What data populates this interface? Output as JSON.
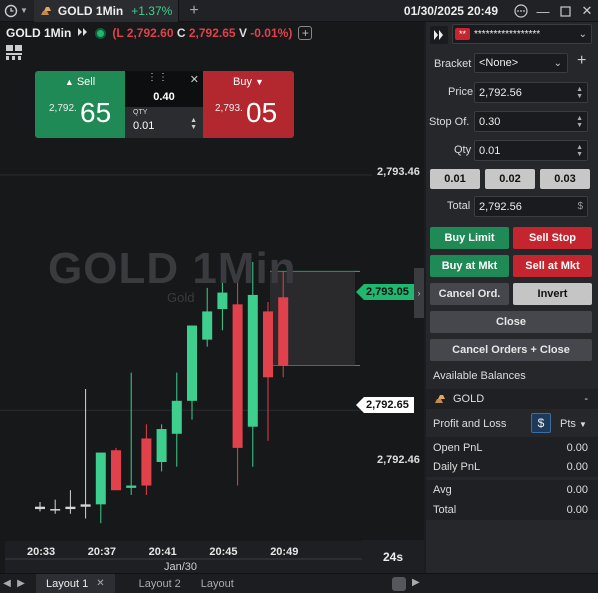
{
  "topbar": {
    "symbol_tab": "GOLD 1Min",
    "change": "+1.37%",
    "datetime": "01/30/2025 20:49"
  },
  "chart": {
    "title": "GOLD 1Min",
    "ohlc_l_label": "(L",
    "ohlc_l_value": "2,792.60",
    "ohlc_c_label": "C",
    "ohlc_c_value": "2,792.65",
    "ohlc_v_label": "V",
    "ohlc_v_value": "-0.01%",
    "ohlc_close": ")",
    "watermark": "GOLD 1Min",
    "watermark_sub": "Gold",
    "price_labels": {
      "top": "2,793.46",
      "ask": "2,793.05",
      "last": "2,792.65",
      "bottom": "2,792.46"
    },
    "countdown": "24s",
    "date_label": "Jan/30"
  },
  "trade_widget": {
    "sell_label": "Sell",
    "sell_prefix": "2,792.",
    "sell_big": "65",
    "buy_label": "Buy",
    "buy_prefix": "2,793.",
    "buy_big": "05",
    "spread": "0.40",
    "qty_label": "QTY",
    "qty_value": "0.01"
  },
  "chart_data": {
    "type": "candlestick",
    "x": [
      "20:32",
      "20:33",
      "20:34",
      "20:35",
      "20:36",
      "20:37",
      "20:38",
      "20:39",
      "20:40",
      "20:41",
      "20:42",
      "20:43",
      "20:44",
      "20:45",
      "20:46",
      "20:47",
      "20:48",
      "20:49"
    ],
    "candles": [
      {
        "o": 2792.05,
        "h": 2792.07,
        "l": 2792.03,
        "c": 2792.04,
        "dir": "flat"
      },
      {
        "o": 2792.04,
        "h": 2792.08,
        "l": 2792.02,
        "c": 2792.04,
        "dir": "flat"
      },
      {
        "o": 2792.04,
        "h": 2792.12,
        "l": 2792.02,
        "c": 2792.05,
        "dir": "flat"
      },
      {
        "o": 2792.05,
        "h": 2792.55,
        "l": 2792.0,
        "c": 2792.06,
        "dir": "flat"
      },
      {
        "o": 2792.06,
        "h": 2792.28,
        "l": 2791.98,
        "c": 2792.28,
        "dir": "up"
      },
      {
        "o": 2792.29,
        "h": 2792.3,
        "l": 2792.18,
        "c": 2792.12,
        "dir": "down"
      },
      {
        "o": 2792.13,
        "h": 2792.62,
        "l": 2792.1,
        "c": 2792.14,
        "dir": "up"
      },
      {
        "o": 2792.14,
        "h": 2792.4,
        "l": 2792.1,
        "c": 2792.34,
        "dir": "down"
      },
      {
        "o": 2792.24,
        "h": 2792.4,
        "l": 2792.2,
        "c": 2792.38,
        "dir": "up"
      },
      {
        "o": 2792.36,
        "h": 2792.62,
        "l": 2792.22,
        "c": 2792.5,
        "dir": "up"
      },
      {
        "o": 2792.5,
        "h": 2792.79,
        "l": 2792.42,
        "c": 2792.82,
        "dir": "up"
      },
      {
        "o": 2792.76,
        "h": 2792.98,
        "l": 2792.73,
        "c": 2792.88,
        "dir": "up"
      },
      {
        "o": 2792.89,
        "h": 2793.08,
        "l": 2792.8,
        "c": 2792.96,
        "dir": "up"
      },
      {
        "o": 2792.91,
        "h": 2793.04,
        "l": 2792.14,
        "c": 2792.3,
        "dir": "down"
      },
      {
        "o": 2792.39,
        "h": 2793.09,
        "l": 2792.22,
        "c": 2792.95,
        "dir": "up"
      },
      {
        "o": 2792.88,
        "h": 2792.92,
        "l": 2792.33,
        "c": 2792.6,
        "dir": "down"
      },
      {
        "o": 2792.94,
        "h": 2793.05,
        "l": 2792.6,
        "c": 2792.65,
        "dir": "down"
      }
    ],
    "x_ticks": [
      "20:33",
      "20:37",
      "20:41",
      "20:45",
      "20:49"
    ],
    "y_ticks": [
      "2,793.46",
      "2,792.46"
    ],
    "ylim": [
      2791.9,
      2793.6
    ],
    "ask": 2793.05,
    "last": 2792.65,
    "grid": true
  },
  "panel": {
    "account_mask": "**",
    "account_value": "*****************",
    "bracket_label": "Bracket",
    "bracket_value": "<None>",
    "price_label": "Price",
    "price_value": "2,792.56",
    "stop_label": "Stop Of.",
    "stop_value": "0.30",
    "qty_label": "Qty",
    "qty_value": "0.01",
    "quick_qty": [
      "0.01",
      "0.02",
      "0.03"
    ],
    "total_label": "Total",
    "total_value": "2,792.56",
    "total_currency": "$",
    "buy_limit": "Buy Limit",
    "sell_stop": "Sell Stop",
    "buy_mkt": "Buy at Mkt",
    "sell_mkt": "Sell at Mkt",
    "cancel_ord": "Cancel Ord.",
    "invert": "Invert",
    "close": "Close",
    "cancel_close": "Cancel Orders + Close",
    "avail_bal": "Available Balances",
    "gold_label": "GOLD",
    "gold_value": "-",
    "pnl_label": "Profit and Loss",
    "pnl_currency": "$",
    "pnl_unit": "Pts",
    "open_pnl_label": "Open PnL",
    "open_pnl_value": "0.00",
    "daily_pnl_label": "Daily PnL",
    "daily_pnl_value": "0.00",
    "avg_label": "Avg",
    "avg_value": "0.00",
    "total2_label": "Total",
    "total2_value": "0.00"
  },
  "bottom": {
    "tabs": [
      "Layout 1",
      "Layout 2",
      "Layout"
    ]
  },
  "colors": {
    "up": "#3ecf8e",
    "down": "#e0414b",
    "bg": "#17181a"
  }
}
